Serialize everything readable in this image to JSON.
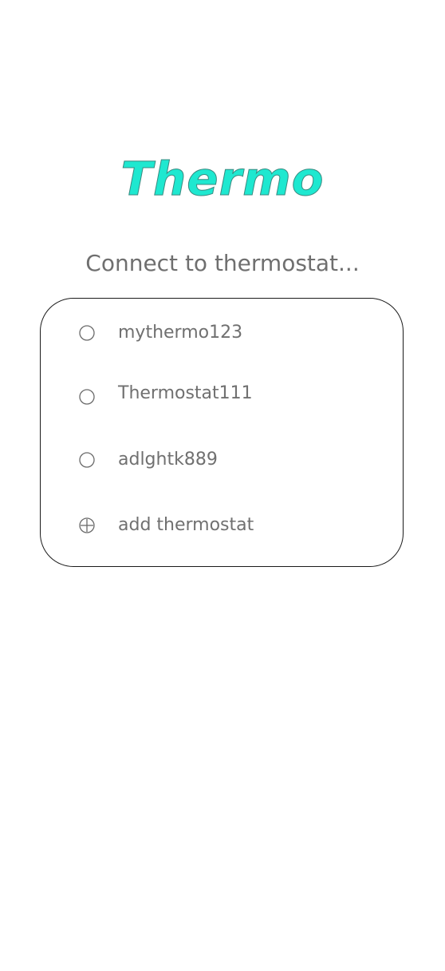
{
  "app": {
    "logo": "Thermo",
    "heading": "Connect to thermostat..."
  },
  "thermostats": [
    {
      "label": "mythermo123",
      "icon": "radio-unchecked-icon"
    },
    {
      "label": "Thermostat111",
      "icon": "radio-unchecked-icon"
    },
    {
      "label": "adlghtk889",
      "icon": "radio-unchecked-icon"
    }
  ],
  "add_item": {
    "label": "add thermostat",
    "icon": "add-circle-icon"
  },
  "colors": {
    "logo": "#1ee8d0",
    "text": "#707070",
    "panel_border": "#1a1a1a",
    "background": "#ffffff"
  }
}
